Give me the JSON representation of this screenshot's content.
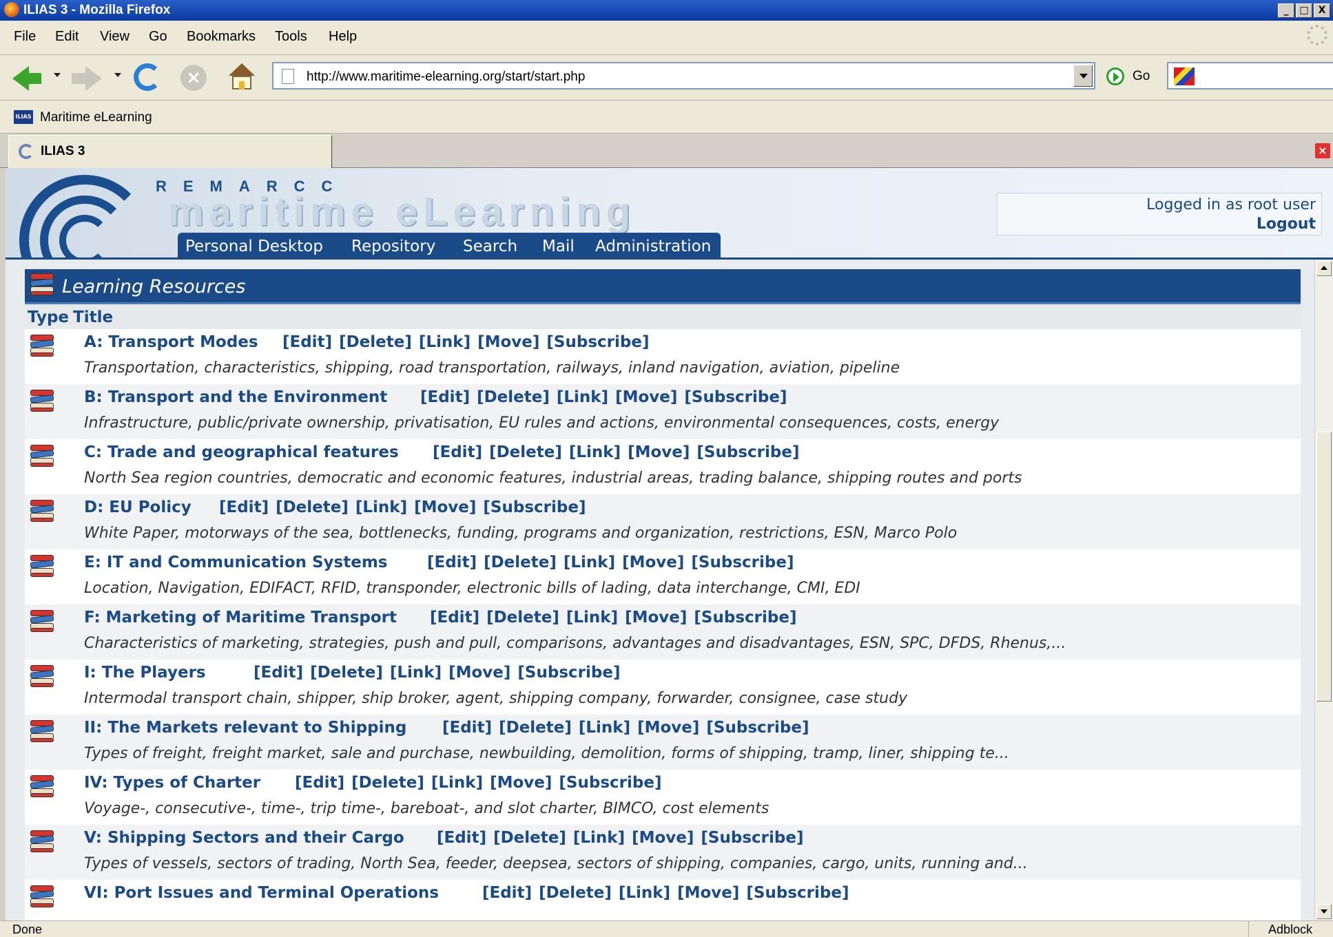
{
  "window": {
    "title": "ILIAS 3 - Mozilla Firefox",
    "controls": [
      "_",
      "□",
      "X"
    ]
  },
  "menu": [
    "File",
    "Edit",
    "View",
    "Go",
    "Bookmarks",
    "Tools",
    "Help"
  ],
  "navbar": {
    "url": "http://www.maritime-elearning.org/start/start.php",
    "go_label": "Go"
  },
  "bookmarks": {
    "icon_text": "ILIAS",
    "label": "Maritime eLearning"
  },
  "tab": {
    "label": "ILIAS 3"
  },
  "header": {
    "brand_top": "REMARCC",
    "brand_main": "maritime eLearning",
    "nav": [
      "Personal Desktop",
      "Repository",
      "Search",
      "Mail",
      "Administration"
    ],
    "login_text": "Logged in as root user",
    "logout": "Logout"
  },
  "panel": {
    "title": "Learning Resources",
    "col_type": "Type",
    "col_title": "Title",
    "actions": [
      "[Edit]",
      "[Delete]",
      "[Link]",
      "[Move]",
      "[Subscribe]"
    ],
    "rows": [
      {
        "title": "A: Transport Modes",
        "desc": "Transportation, characteristics, shipping, road transportation, railways, inland navigation, aviation, pipeline"
      },
      {
        "title": "B: Transport and the Environment",
        "desc": "Infrastructure, public/private ownership, privatisation, EU rules and actions, environmental consequences, costs, energy"
      },
      {
        "title": "C: Trade and geographical features",
        "desc": "North Sea region countries, democratic and economic features, industrial areas, trading balance, shipping routes and ports"
      },
      {
        "title": "D: EU Policy",
        "desc": "White Paper, motorways of the sea, bottlenecks, funding, programs and organization, restrictions, ESN, Marco Polo"
      },
      {
        "title": "E: IT and Communication Systems",
        "desc": "Location, Navigation, EDIFACT, RFID, transponder, electronic bills of lading, data interchange, CMI, EDI"
      },
      {
        "title": "F: Marketing of Maritime Transport",
        "desc": "Characteristics of marketing, strategies, push and pull, comparisons, advantages and disadvantages, ESN, SPC, DFDS, Rhenus,..."
      },
      {
        "title": "I: The Players",
        "desc": "Intermodal transport chain, shipper, ship broker, agent, shipping company, forwarder, consignee, case study"
      },
      {
        "title": "II: The Markets relevant to Shipping",
        "desc": "Types of freight, freight market, sale and purchase, newbuilding, demolition, forms of shipping, tramp, liner, shipping te..."
      },
      {
        "title": "IV: Types of Charter",
        "desc": "Voyage-, consecutive-, time-, trip time-, bareboat-, and slot charter, BIMCO, cost elements"
      },
      {
        "title": "V: Shipping Sectors and their Cargo",
        "desc": "Types of vessels, sectors of trading, North Sea, feeder, deepsea, sectors of shipping, companies, cargo, units, running and..."
      },
      {
        "title": "VI: Port Issues and Terminal Operations",
        "desc": ""
      }
    ]
  },
  "status": {
    "text": "Done",
    "addon": "Adblock"
  }
}
